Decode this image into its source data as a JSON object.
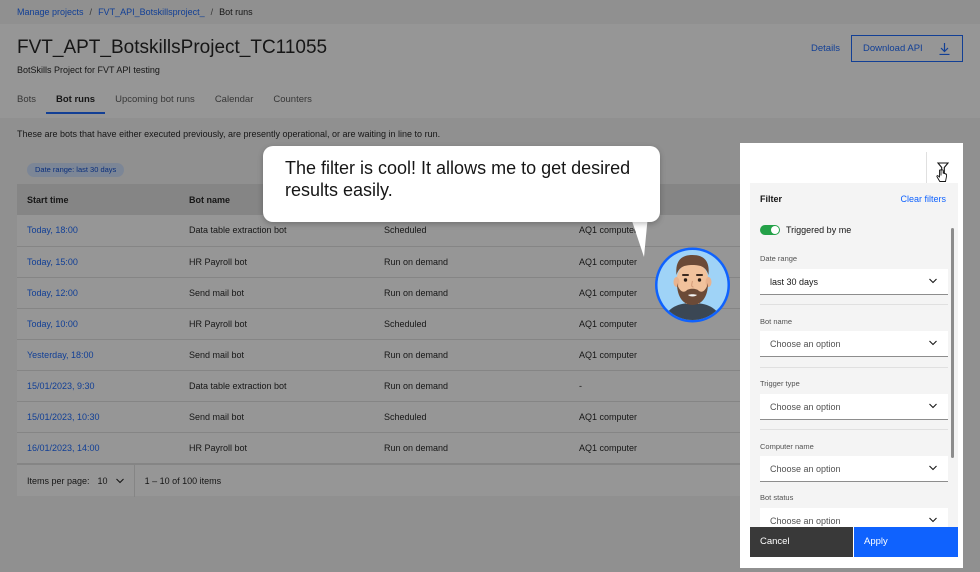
{
  "breadcrumb": [
    "Manage projects",
    "FVT_API_Botskillsproject_",
    "Bot runs"
  ],
  "page": {
    "title": "FVT_APT_BotskillsProject_TC11055",
    "subtitle": "BotSkills Project for FVT API testing",
    "details_label": "Details",
    "download_label": "Download API"
  },
  "tabs": [
    "Bots",
    "Bot runs",
    "Upcoming bot runs",
    "Calendar",
    "Counters"
  ],
  "intro": "These are bots that have either executed previously, are presently operational, or are waiting in line to run.",
  "table": {
    "tag": "Date range: last 30 days",
    "headers": [
      "Start time",
      "Bot name",
      "",
      ""
    ],
    "rows": [
      [
        "Today, 18:00",
        "Data table extraction bot",
        "Scheduled",
        "AQ1 computer"
      ],
      [
        "Today, 15:00",
        "HR Payroll bot",
        "Run on demand",
        "AQ1 computer"
      ],
      [
        "Today, 12:00",
        "Send mail bot",
        "Run on demand",
        "AQ1 computer"
      ],
      [
        "Today, 10:00",
        "HR Payroll bot",
        "Scheduled",
        "AQ1 computer"
      ],
      [
        "Yesterday, 18:00",
        "Send mail bot",
        "Run on demand",
        "AQ1 computer"
      ],
      [
        "15/01/2023, 9:30",
        "Data table extraction bot",
        "Run on demand",
        "-"
      ],
      [
        "15/01/2023, 10:30",
        "Send mail bot",
        "Scheduled",
        "AQ1 computer"
      ],
      [
        "16/01/2023, 14:00",
        "HR Payroll bot",
        "Run on demand",
        "AQ1 computer"
      ]
    ],
    "items_per_page_label": "Items per page:",
    "items_per_page_value": "10",
    "range": "1 – 10 of 100 items"
  },
  "bubble": {
    "text": "The filter is cool! It allows me to get desired results easily."
  },
  "filter": {
    "title": "Filter",
    "clear": "Clear filters",
    "toggle_label": "Triggered by me",
    "fields": [
      {
        "label": "Date range",
        "value": "last 30 days"
      },
      {
        "label": "Bot name",
        "value": "Choose an option"
      },
      {
        "label": "Trigger type",
        "value": "Choose an option"
      },
      {
        "label": "Computer name",
        "value": "Choose an option"
      },
      {
        "label": "Bot status",
        "value": "Choose an option"
      }
    ],
    "cancel": "Cancel",
    "apply": "Apply"
  },
  "colors": {
    "accent": "#0f62fe",
    "toggle_on": "#24a148",
    "tag_bg": "#d0e2ff"
  },
  "icons": [
    "download-icon",
    "filter-icon",
    "chevron-down-icon",
    "cursor-hand-icon"
  ]
}
